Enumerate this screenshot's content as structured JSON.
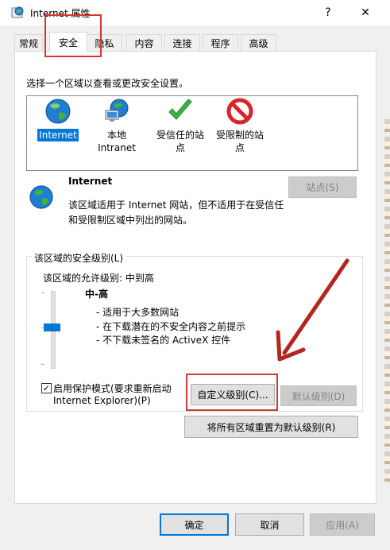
{
  "window": {
    "title": "Internet 属性",
    "help_glyph": "?",
    "close_glyph": "✕"
  },
  "tabs": [
    {
      "label": "常规",
      "selected": false
    },
    {
      "label": "安全",
      "selected": true
    },
    {
      "label": "隐私",
      "selected": false
    },
    {
      "label": "内容",
      "selected": false
    },
    {
      "label": "连接",
      "selected": false
    },
    {
      "label": "程序",
      "selected": false
    },
    {
      "label": "高级",
      "selected": false
    }
  ],
  "security": {
    "zone_prompt": "选择一个区域以查看或更改安全设置。",
    "zones": [
      {
        "line1": "Internet",
        "line2": "",
        "icon": "globe-icon",
        "selected": true
      },
      {
        "line1": "本地",
        "line2": "Intranet",
        "icon": "intranet-icon",
        "selected": false
      },
      {
        "line1": "受信任的站",
        "line2": "点",
        "icon": "checkmark-icon",
        "selected": false
      },
      {
        "line1": "受限制的站",
        "line2": "点",
        "icon": "restricted-icon",
        "selected": false
      }
    ],
    "zone_info": {
      "name": "Internet",
      "desc_line1": "该区域适用于 Internet 网站，但不适用于在受信任",
      "desc_line2": "和受限制区域中列出的网站。",
      "sites_button": "站点(S)"
    },
    "level": {
      "group_title": "该区域的安全级别(L)",
      "allowed": "该区域的允许级别: 中到高",
      "name": "中-高",
      "bullets": [
        "- 适用于大多数网站",
        "- 在下载潜在的不安全内容之前提示",
        "- 不下载未签名的 ActiveX 控件"
      ],
      "slider_level_index": 2,
      "slider_levels": 3
    },
    "protected_mode": {
      "checked": true,
      "line1": "启用保护模式(要求重新启动",
      "line2": "Internet Explorer)(P)"
    },
    "custom_button": "自定义级别(C)...",
    "default_button": "默认级别(D)",
    "reset_all_button": "将所有区域重置为默认级别(R)"
  },
  "footer": {
    "ok": "确定",
    "cancel": "取消",
    "apply": "应用(A)"
  },
  "colors": {
    "accent": "#0078d7",
    "annotation_red": "#d23a2f",
    "annotation_arrow": "#b3261e"
  }
}
